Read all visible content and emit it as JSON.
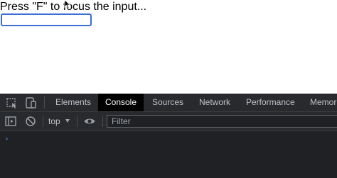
{
  "page": {
    "prompt_text": "Press \"F\" to focus the input...",
    "input_value": ""
  },
  "devtools": {
    "tabs": [
      {
        "label": "Elements"
      },
      {
        "label": "Console"
      },
      {
        "label": "Sources"
      },
      {
        "label": "Network"
      },
      {
        "label": "Performance"
      },
      {
        "label": "Memor"
      }
    ],
    "active_tab": "Console",
    "toolbar": {
      "context_label": "top",
      "filter_placeholder": "Filter"
    },
    "console": {
      "prompt_symbol": "›"
    }
  },
  "colors": {
    "accent_focus": "#3b6fd6",
    "devtools_bg": "#202124",
    "tab_active_bg": "#000000",
    "prompt_blue": "#4b8df8"
  },
  "icons": [
    "mouse-cursor-icon",
    "inspect-element-icon",
    "device-toolbar-icon",
    "sidebar-toggle-icon",
    "clear-console-icon",
    "dropdown-arrow-icon",
    "eye-icon"
  ]
}
